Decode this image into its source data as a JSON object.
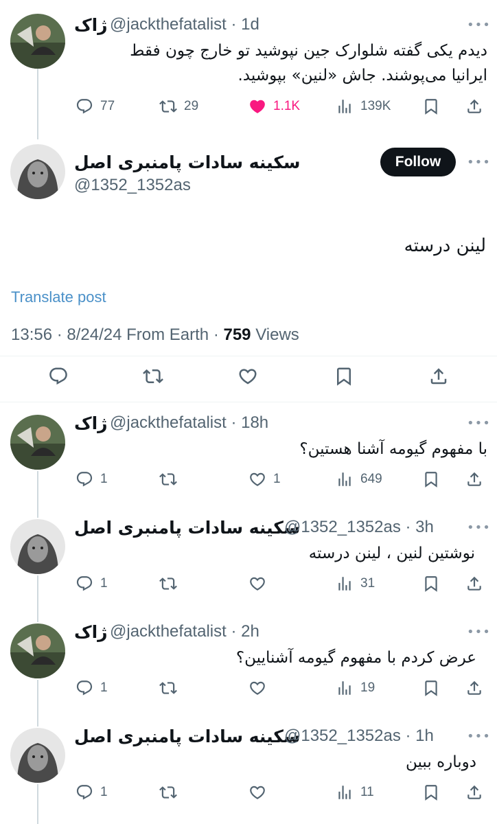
{
  "thread": {
    "parent": {
      "name": "ژاک",
      "handle": "@jackthefatalist",
      "time": "· 1d",
      "text": "دیدم یکی گفته شلوارک جین نپوشید تو خارج چون فقط ایرانیا می‌پوشند. جاش «لنین» بپوشید.",
      "replies": "77",
      "reposts": "29",
      "likes": "1.1K",
      "views": "139K"
    },
    "main": {
      "name": "سکینه سادات پامنبری اصل",
      "handle": "@1352_1352as",
      "follow_label": "Follow",
      "text": "لینن درسته",
      "translate_label": "Translate post",
      "meta_time": "13:56 · 8/24/24 From Earth · ",
      "meta_views_count": "759",
      "meta_views_label": " Views"
    },
    "replies": [
      {
        "name": "ژاک",
        "handle": "@jackthefatalist",
        "time": "· 18h",
        "text": "با مفهوم گیومه آشنا هستین؟",
        "replies": "1",
        "likes": "1",
        "views": "649"
      },
      {
        "name": "سکینه سادات پامنبری اصل",
        "handle": "@1352_1352as",
        "time": "· 3h",
        "text": "نوشتین لنین ، لینن درسته",
        "replies": "1",
        "likes": "",
        "views": "31"
      },
      {
        "name": "ژاک",
        "handle": "@jackthefatalist",
        "time": "· 2h",
        "text": "عرض کردم با مفهوم گیومه آشنایین؟",
        "replies": "1",
        "likes": "",
        "views": "19"
      },
      {
        "name": "سکینه سادات پامنبری اصل",
        "handle": "@1352_1352as",
        "time": "· 1h",
        "text": "دوباره ببین",
        "replies": "1",
        "likes": "",
        "views": "11"
      }
    ]
  },
  "colors": {
    "like_active": "#f91880",
    "link": "#4a90c8",
    "muted": "#536471",
    "follow_bg": "#0f1419"
  },
  "icons": [
    "reply-icon",
    "repost-icon",
    "like-icon",
    "views-icon",
    "bookmark-icon",
    "share-icon",
    "more-icon"
  ]
}
